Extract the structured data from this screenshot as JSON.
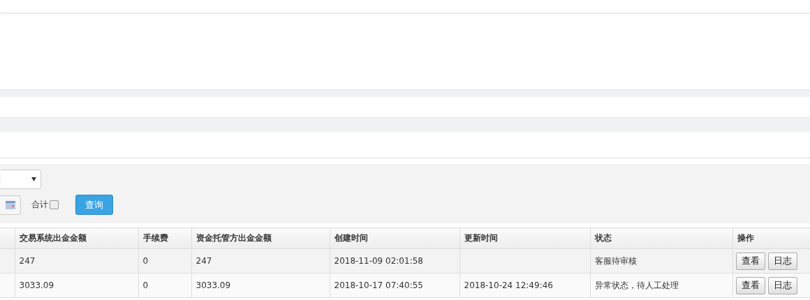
{
  "filter": {
    "sum_checkbox": {
      "label": "合计",
      "checked": false
    },
    "query_button": "查询"
  },
  "table": {
    "columns": [
      "",
      "交易系统出金金额",
      "手续费",
      "资金托管方出金金额",
      "创建时间",
      "更新时间",
      "状态",
      "操作"
    ],
    "rows": [
      {
        "cells": [
          "",
          "247",
          "0",
          "247",
          "2018-11-09 02:01:58",
          "",
          "客服待审核"
        ],
        "actions": [
          "查看",
          "日志"
        ]
      },
      {
        "cells": [
          "",
          "3033.09",
          "0",
          "3033.09",
          "2018-10-17 07:40:55",
          "2018-10-24 12:49:46",
          "异常状态，待人工处理"
        ],
        "actions": [
          "查看",
          "日志"
        ]
      }
    ]
  }
}
